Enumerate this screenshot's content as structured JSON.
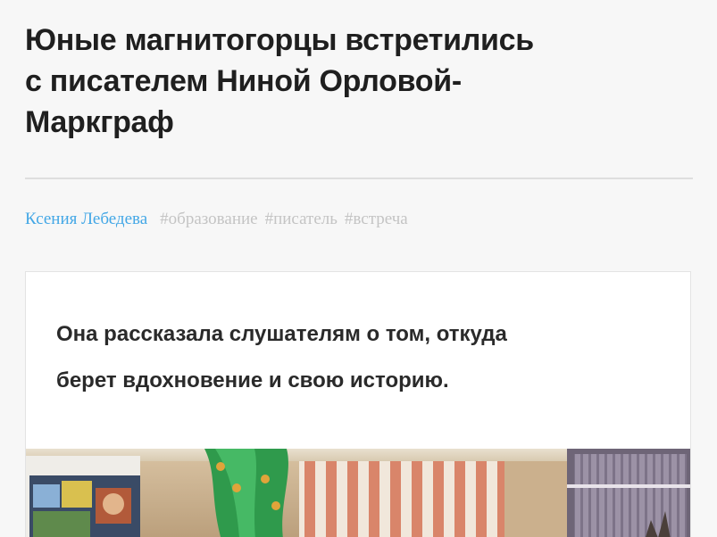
{
  "article": {
    "title_lines": [
      "Юные магнитогорцы встретились",
      "с писателем Ниной Орловой-",
      "Маркграф"
    ],
    "author": "Ксения Лебедева",
    "tags": [
      "#образование",
      "#писатель",
      "#встреча"
    ],
    "lead_lines": [
      "Она рассказала слушателям о том, откуда",
      "берет вдохновение и свою историю."
    ]
  },
  "colors": {
    "author_link": "#43a7e6",
    "tag_text": "#c4c4c4",
    "title_text": "#1f1f1f"
  }
}
